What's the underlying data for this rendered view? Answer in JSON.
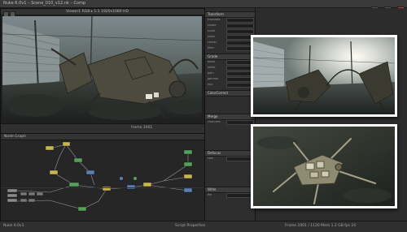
{
  "window": {
    "title": "Nuke 6.0v1 – Scene_010_v12.nk – Comp"
  },
  "viewer": {
    "header_text": "Viewer1  RGB  ▸  1:1  1920x1080  HD",
    "footer_text": "frame 1001"
  },
  "node_graph": {
    "header_text": "Node Graph"
  },
  "properties": {
    "sections": [
      "Transform",
      "Grade",
      "ColorCorrect",
      "Merge",
      "Defocus",
      "Write"
    ],
    "labels": [
      "translate",
      "rotate",
      "scale",
      "skew",
      "center",
      "filter",
      "black",
      "white",
      "gain",
      "gamma",
      "mix",
      "channels",
      "size",
      "file"
    ]
  },
  "status_bar": {
    "left_text": "Nuke 6.0v1",
    "center_text": "Script Properties",
    "right_text": "Frame 1001 / 1120   Mem 1.2 GB   fps 24"
  },
  "colors": {
    "app_bg": "#2a2a2a",
    "panel_bg": "#262626",
    "node_yellow": "#c8b650",
    "node_green": "#56a05a",
    "node_blue": "#5a7fb3",
    "wire": "#9a9a9a"
  }
}
